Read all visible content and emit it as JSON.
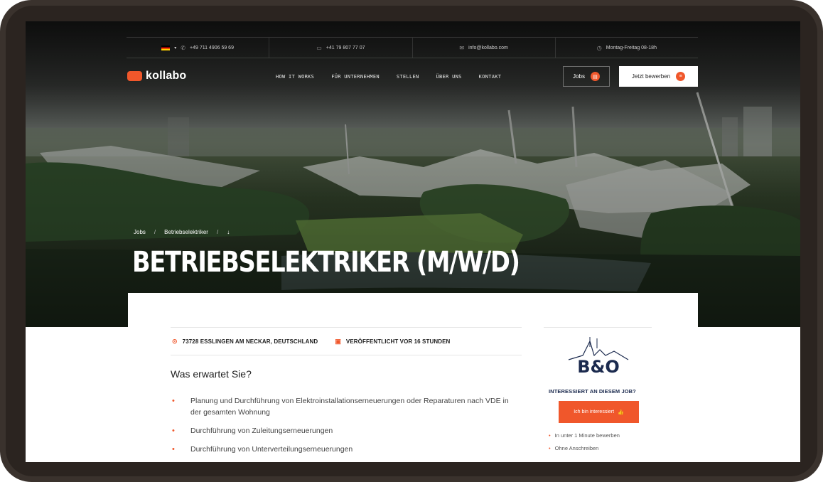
{
  "topbar": {
    "phone1": "+49 711 4906 59 69",
    "phone2": "+41 79 807 77 07",
    "email": "info@kollabo.com",
    "hours": "Montag-Freitag 08-18h"
  },
  "brand": {
    "name": "kollabo",
    "accent": "#f0572b"
  },
  "nav": {
    "items": [
      "HOW IT WORKS",
      "FÜR UNTERNEHMEN",
      "STELLEN",
      "ÜBER UNS",
      "KONTAKT"
    ],
    "jobs_label": "Jobs",
    "apply_label": "Jetzt bewerben"
  },
  "breadcrumb": {
    "home": "Jobs",
    "current": "Betriebselektriker"
  },
  "job": {
    "title": "BETRIEBSELEKTRIKER (M/W/D)",
    "location": "73728 ESSLINGEN AM NECKAR, DEUTSCHLAND",
    "published": "VERÖFFENTLICHT VOR 16 STUNDEN",
    "section_title": "Was erwartet Sie?",
    "bullets": [
      "Planung und Durchführung von Elektroinstallationserneuerungen oder Reparaturen nach VDE in der gesamten Wohnung",
      "Durchführung von Zuleitungserneuerungen",
      "Durchführung von Unterverteilungserneuerungen"
    ]
  },
  "sidebar": {
    "logo_text": "B&O",
    "title": "INTERESSIERT AN DIESEM JOB?",
    "button_label": "Ich bin interessiert",
    "points": [
      "In unter 1 Minute bewerben",
      "Ohne Anschreiben"
    ]
  },
  "icons": {
    "phone": "phone-icon",
    "mobile": "mobile-icon",
    "mail": "mail-icon",
    "clock": "clock-icon",
    "location": "location-pin-icon",
    "calendar": "calendar-icon"
  }
}
